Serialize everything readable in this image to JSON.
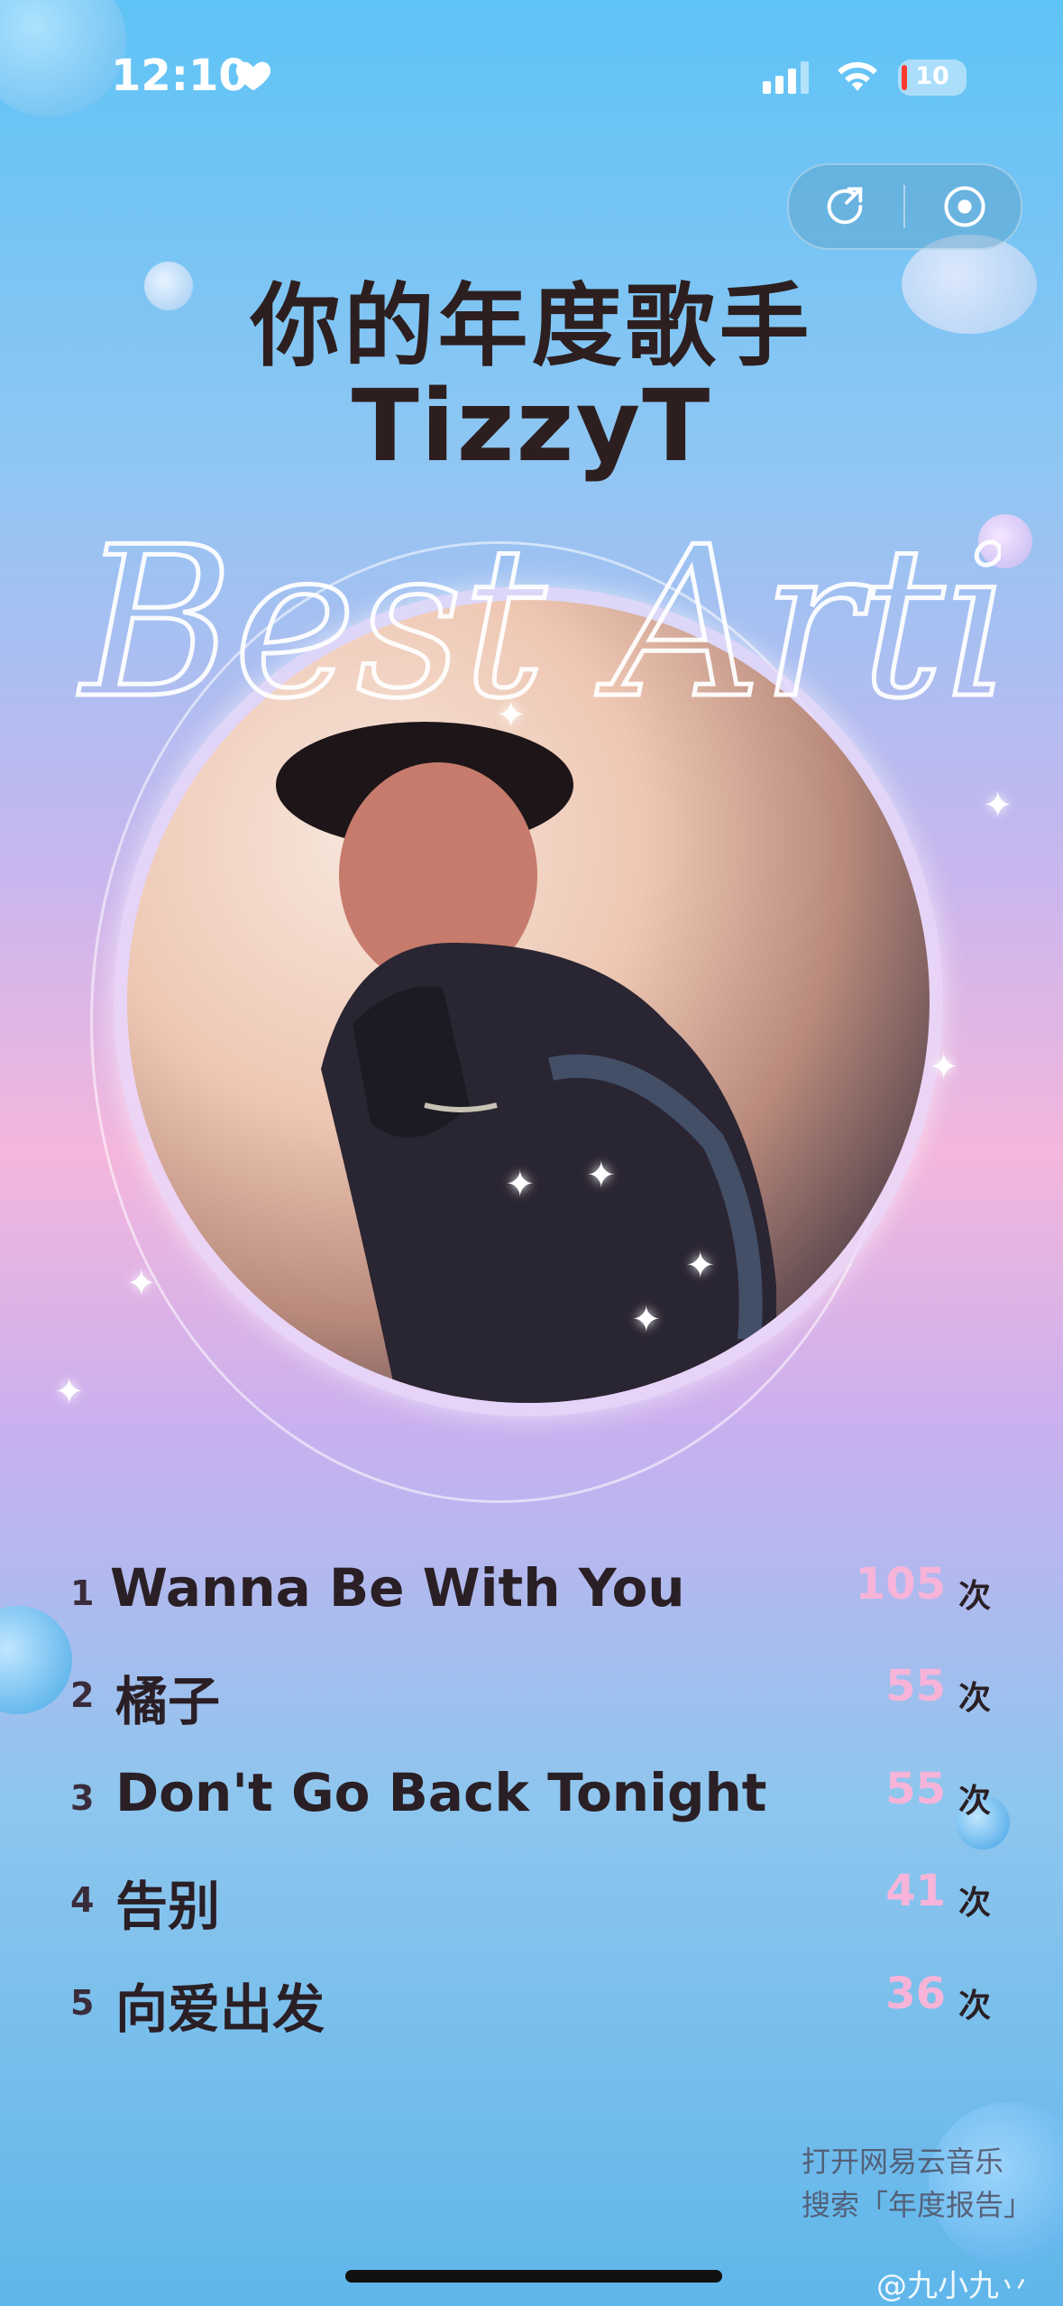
{
  "status_bar": {
    "time": "12:10",
    "heart_icon": "heart-icon",
    "battery_level": "10"
  },
  "header": {
    "title": "你的年度歌手",
    "artist": "TizzyT",
    "script_overlay": "Best Artist"
  },
  "top_buttons": {
    "share_icon": "share-icon",
    "record_icon": "record-icon"
  },
  "songs": [
    {
      "rank": "1",
      "title": "Wanna Be With You",
      "count": "105",
      "unit": "次"
    },
    {
      "rank": "2",
      "title": "橘子",
      "count": "55",
      "unit": "次"
    },
    {
      "rank": "3",
      "title": "Don't Go Back Tonight",
      "count": "55",
      "unit": "次"
    },
    {
      "rank": "4",
      "title": "告别",
      "count": "41",
      "unit": "次"
    },
    {
      "rank": "5",
      "title": "向爱出发",
      "count": "36",
      "unit": "次"
    }
  ],
  "promo": {
    "line1": "打开网易云音乐",
    "line2": "搜索「年度报告」"
  },
  "watermark": "@九小九丷",
  "colors": {
    "count_pink": "#f7b4d8",
    "title_dark": "#2d1f1f"
  }
}
